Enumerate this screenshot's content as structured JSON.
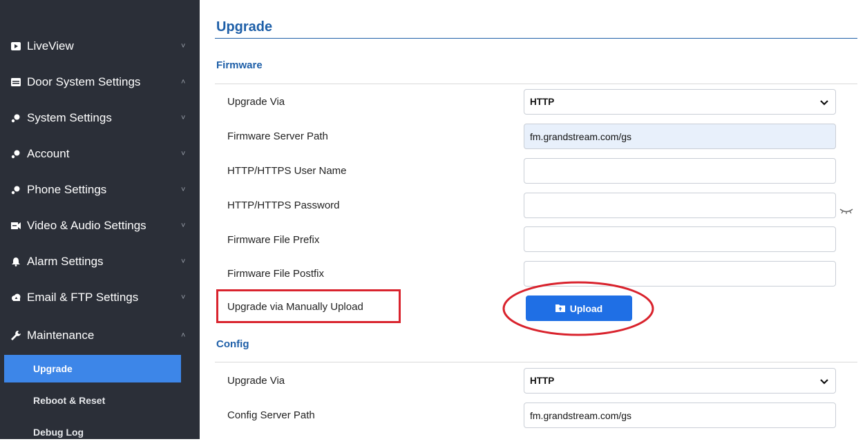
{
  "sidebar": {
    "items": [
      {
        "label": "LiveView",
        "icon": "video-icon"
      },
      {
        "label": "Door System Settings",
        "icon": "door-panel-icon"
      },
      {
        "label": "System Settings",
        "icon": "gear-icon"
      },
      {
        "label": "Account",
        "icon": "gear-icon"
      },
      {
        "label": "Phone Settings",
        "icon": "gear-icon"
      },
      {
        "label": "Video & Audio Settings",
        "icon": "av-icon"
      },
      {
        "label": "Alarm Settings",
        "icon": "bell-icon"
      },
      {
        "label": "Email & FTP Settings",
        "icon": "cloud-icon"
      },
      {
        "label": "Maintenance",
        "icon": "wrench-icon"
      }
    ],
    "sub_items": [
      {
        "label": "Upgrade",
        "active": true
      },
      {
        "label": "Reboot & Reset",
        "active": false
      },
      {
        "label": "Debug Log",
        "active": false
      }
    ],
    "chevron_down": "˅",
    "chevron_up": "˄"
  },
  "main": {
    "title": "Upgrade",
    "firmware": {
      "heading": "Firmware",
      "upgrade_via_label": "Upgrade Via",
      "upgrade_via_value": "HTTP",
      "server_path_label": "Firmware Server Path",
      "server_path_value": "fm.grandstream.com/gs",
      "user_name_label": "HTTP/HTTPS User Name",
      "user_name_value": "",
      "password_label": "HTTP/HTTPS Password",
      "password_value": "",
      "prefix_label": "Firmware File Prefix",
      "prefix_value": "",
      "postfix_label": "Firmware File Postfix",
      "postfix_value": "",
      "manual_upload_label": "Upgrade via Manually Upload",
      "upload_button": "Upload"
    },
    "config": {
      "heading": "Config",
      "upgrade_via_label": "Upgrade Via",
      "upgrade_via_value": "HTTP",
      "server_path_label": "Config Server Path",
      "server_path_value": "fm.grandstream.com/gs"
    }
  },
  "colors": {
    "sidebar_bg": "#2b2f38",
    "active_item": "#3d86e8",
    "title_blue": "#1e5fa8",
    "upload_button": "#1f6fe5",
    "annotation_red": "#d9232d"
  }
}
